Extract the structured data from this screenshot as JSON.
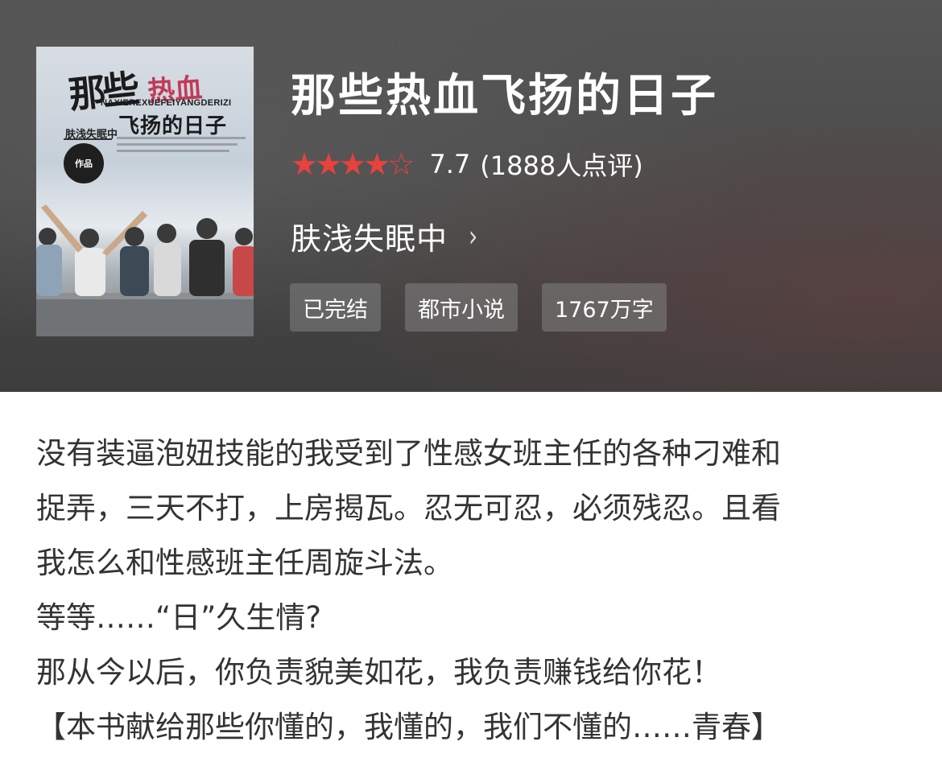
{
  "book": {
    "cover": {
      "title_part1": "那些",
      "title_part2": "热血",
      "pinyin": "NAXIEREXUEFEIYANGDERIZI",
      "title_part3": "飞扬的日子",
      "author": "肤浅失眠中",
      "works_badge": "作品"
    },
    "title": "那些热血飞扬的日子",
    "rating": {
      "stars_filled": 4,
      "stars_total": 5,
      "score": "7.7",
      "count_text": "(1888人点评)",
      "star_color": "#e8413e"
    },
    "author": "肤浅失眠中",
    "author_chevron": "›",
    "tags": [
      "已完结",
      "都市小说",
      "1767万字"
    ]
  },
  "synopsis": {
    "lines": [
      "没有装逼泡妞技能的我受到了性感女班主任的各种刁难和",
      "捉弄，三天不打，上房揭瓦。忍无可忍，必须残忍。且看",
      "我怎么和性感班主任周旋斗法。",
      "等等……“日”久生情?",
      "那从今以后，你负责貌美如花，我负责赚钱给你花！",
      "【本书献给那些你懂的，我懂的，我们不懂的……青春】"
    ]
  }
}
